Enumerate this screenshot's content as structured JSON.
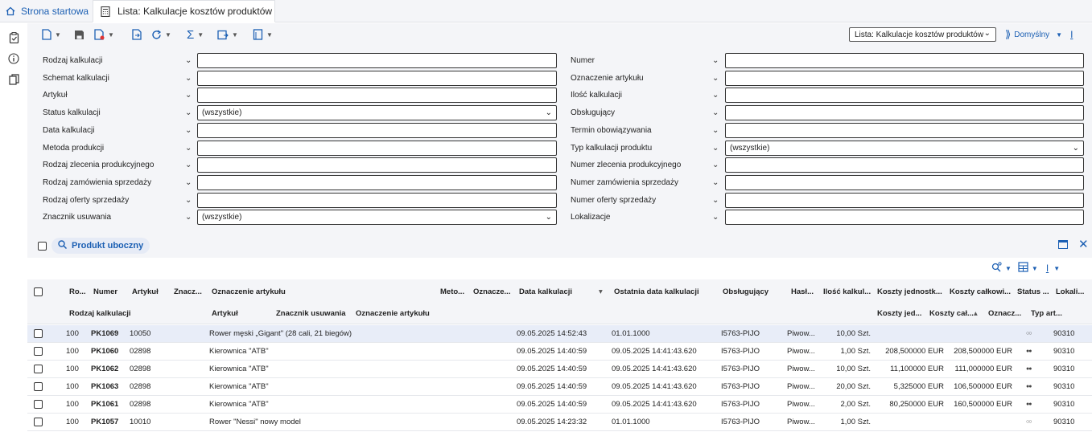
{
  "tabs": {
    "home": "Strona startowa",
    "active": "Lista: Kalkulacje kosztów produktów"
  },
  "toolbar": {
    "view_select": "Lista: Kalkulacje kosztów produktów",
    "default_label": "Domyślny"
  },
  "filters": {
    "left": [
      {
        "label": "Rodzaj kalkulacji",
        "value": ""
      },
      {
        "label": "Schemat kalkulacji",
        "value": ""
      },
      {
        "label": "Artykuł",
        "value": ""
      },
      {
        "label": "Status kalkulacji",
        "value": "(wszystkie)",
        "dropdown": true
      },
      {
        "label": "Data kalkulacji",
        "value": ""
      },
      {
        "label": "Metoda produkcji",
        "value": ""
      },
      {
        "label": "Rodzaj zlecenia produkcyjnego",
        "value": ""
      },
      {
        "label": "Rodzaj zamówienia sprzedaży",
        "value": ""
      },
      {
        "label": "Rodzaj oferty sprzedaży",
        "value": ""
      },
      {
        "label": "Znacznik usuwania",
        "value": "(wszystkie)",
        "dropdown": true
      }
    ],
    "right": [
      {
        "label": "Numer",
        "value": ""
      },
      {
        "label": "Oznaczenie artykułu",
        "value": ""
      },
      {
        "label": "Ilość kalkulacji",
        "value": ""
      },
      {
        "label": "Obsługujący",
        "value": ""
      },
      {
        "label": "Termin obowiązywania",
        "value": ""
      },
      {
        "label": "Typ kalkulacji produktu",
        "value": "(wszystkie)",
        "dropdown": true
      },
      {
        "label": "Numer zlecenia produkcyjnego",
        "value": ""
      },
      {
        "label": "Numer zamówienia sprzedaży",
        "value": ""
      },
      {
        "label": "Numer oferty sprzedaży",
        "value": ""
      },
      {
        "label": "Lokalizacje",
        "value": ""
      }
    ]
  },
  "grid": {
    "search_chip": "Produkt uboczny",
    "header1": [
      "Ro...",
      "Numer",
      "Artykuł",
      "Znacz...",
      "Oznaczenie artykułu",
      "Meto...",
      "Oznacze...",
      "Data kalkulacji",
      "Ostatnia data kalkulacji",
      "Obsługujący",
      "Hasł...",
      "Ilość kalkul...",
      "Koszty jednostk...",
      "Koszty całkowi...",
      "Status ...",
      "Lokali..."
    ],
    "header2": [
      "Rodzaj kalkulacji",
      "Artykuł",
      "Znacznik usuwania",
      "Oznaczenie artykułu",
      "Koszty jed...",
      "Koszty cał...",
      "Oznacz...",
      "Typ art..."
    ],
    "rows": [
      {
        "ro": "100",
        "numer": "PK1069",
        "artykul": "10050",
        "oznaczenie": "Rower męski „Gigant\" (28 cali, 21 biegów)",
        "data": "09.05.2025 14:52:43",
        "ostatnia": "01.01.1000",
        "obsl": "I5763-PIJO",
        "hasl": "Piwow...",
        "ilosc": "10,00 Szt.",
        "kj": "",
        "kc": "",
        "status": "○○",
        "lok": "90310"
      },
      {
        "ro": "100",
        "numer": "PK1060",
        "artykul": "02898",
        "oznaczenie": "Kierownica \"ATB\"",
        "data": "09.05.2025 14:40:59",
        "ostatnia": "09.05.2025 14:41:43.620",
        "obsl": "I5763-PIJO",
        "hasl": "Piwow...",
        "ilosc": "1,00 Szt.",
        "kj": "208,500000 EUR",
        "kc": "208,500000 EUR",
        "status": "●●",
        "lok": "90310"
      },
      {
        "ro": "100",
        "numer": "PK1062",
        "artykul": "02898",
        "oznaczenie": "Kierownica \"ATB\"",
        "data": "09.05.2025 14:40:59",
        "ostatnia": "09.05.2025 14:41:43.620",
        "obsl": "I5763-PIJO",
        "hasl": "Piwow...",
        "ilosc": "10,00 Szt.",
        "kj": "11,100000 EUR",
        "kc": "111,000000 EUR",
        "status": "●●",
        "lok": "90310"
      },
      {
        "ro": "100",
        "numer": "PK1063",
        "artykul": "02898",
        "oznaczenie": "Kierownica \"ATB\"",
        "data": "09.05.2025 14:40:59",
        "ostatnia": "09.05.2025 14:41:43.620",
        "obsl": "I5763-PIJO",
        "hasl": "Piwow...",
        "ilosc": "20,00 Szt.",
        "kj": "5,325000 EUR",
        "kc": "106,500000 EUR",
        "status": "●●",
        "lok": "90310"
      },
      {
        "ro": "100",
        "numer": "PK1061",
        "artykul": "02898",
        "oznaczenie": "Kierownica \"ATB\"",
        "data": "09.05.2025 14:40:59",
        "ostatnia": "09.05.2025 14:41:43.620",
        "obsl": "I5763-PIJO",
        "hasl": "Piwow...",
        "ilosc": "2,00 Szt.",
        "kj": "80,250000 EUR",
        "kc": "160,500000 EUR",
        "status": "●●",
        "lok": "90310"
      },
      {
        "ro": "100",
        "numer": "PK1057",
        "artykul": "10010",
        "oznaczenie": "Rower \"Nessi\" nowy model",
        "data": "09.05.2025 14:23:32",
        "ostatnia": "01.01.1000",
        "obsl": "I5763-PIJO",
        "hasl": "Piwow...",
        "ilosc": "1,00 Szt.",
        "kj": "",
        "kc": "",
        "status": "○○",
        "lok": "90310"
      }
    ]
  },
  "colors": {
    "accent": "#1b5fb3",
    "panel": "#f4f5f8",
    "selected_row": "#e8edf8"
  }
}
